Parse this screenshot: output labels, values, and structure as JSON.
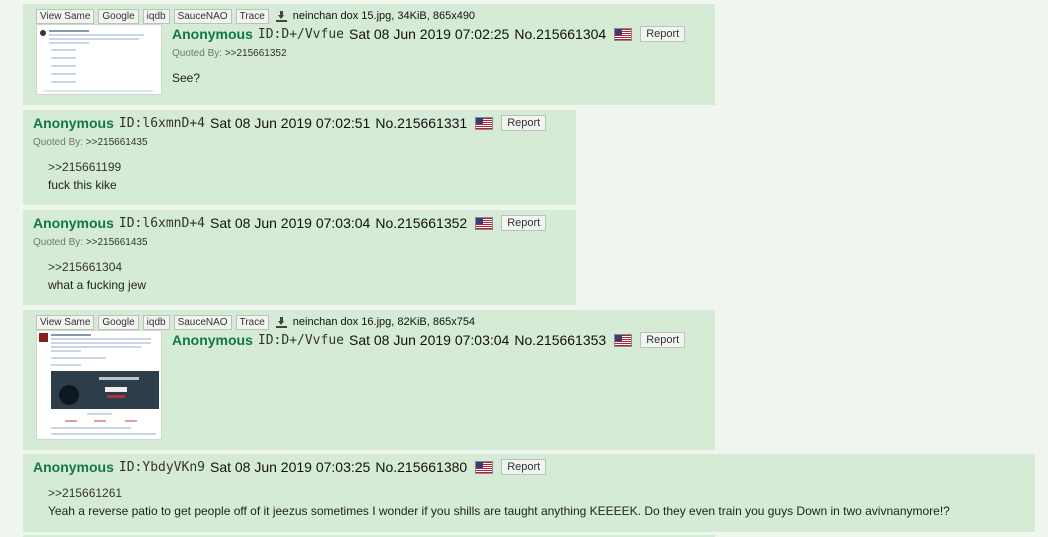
{
  "file_buttons": [
    "View Same",
    "Google",
    "iqdb",
    "SauceNAO",
    "Trace"
  ],
  "posts": [
    {
      "file": "neinchan dox 15.jpg, 34KiB, 865x490",
      "name": "Anonymous",
      "id": "ID:D+/Vvfue",
      "date": "Sat 08 Jun 2019 07:02:25",
      "number": "No.215661304",
      "report": "Report",
      "quoted_by_label": "Quoted By:",
      "quoted_by": ">>215661352",
      "quote": "",
      "text": "See?"
    },
    {
      "name": "Anonymous",
      "id": "ID:l6xmnD+4",
      "date": "Sat 08 Jun 2019 07:02:51",
      "number": "No.215661331",
      "report": "Report",
      "quoted_by_label": "Quoted By:",
      "quoted_by": ">>215661435",
      "quote": ">>215661199",
      "text": "fuck this kike"
    },
    {
      "name": "Anonymous",
      "id": "ID:l6xmnD+4",
      "date": "Sat 08 Jun 2019 07:03:04",
      "number": "No.215661352",
      "report": "Report",
      "quoted_by_label": "Quoted By:",
      "quoted_by": ">>215661435",
      "quote": ">>215661304",
      "text": "what a fucking jew"
    },
    {
      "file": "neinchan dox 16.jpg, 82KiB, 865x754",
      "name": "Anonymous",
      "id": "ID:D+/Vvfue",
      "date": "Sat 08 Jun 2019 07:03:04",
      "number": "No.215661353",
      "report": "Report"
    },
    {
      "name": "Anonymous",
      "id": "ID:YbdyVKn9",
      "date": "Sat 08 Jun 2019 07:03:25",
      "number": "No.215661380",
      "report": "Report",
      "quote": ">>215661261",
      "text": "Yeah a reverse patio to get people off of it jeezus sometimes I wonder if you shills are taught anything KEEEEK. Do they even train you guys Down in two avivnanymore!?"
    }
  ],
  "colors": {
    "name": "#117743",
    "post_bg": "#d6ebd6",
    "page_bg": "#eef6ee"
  }
}
